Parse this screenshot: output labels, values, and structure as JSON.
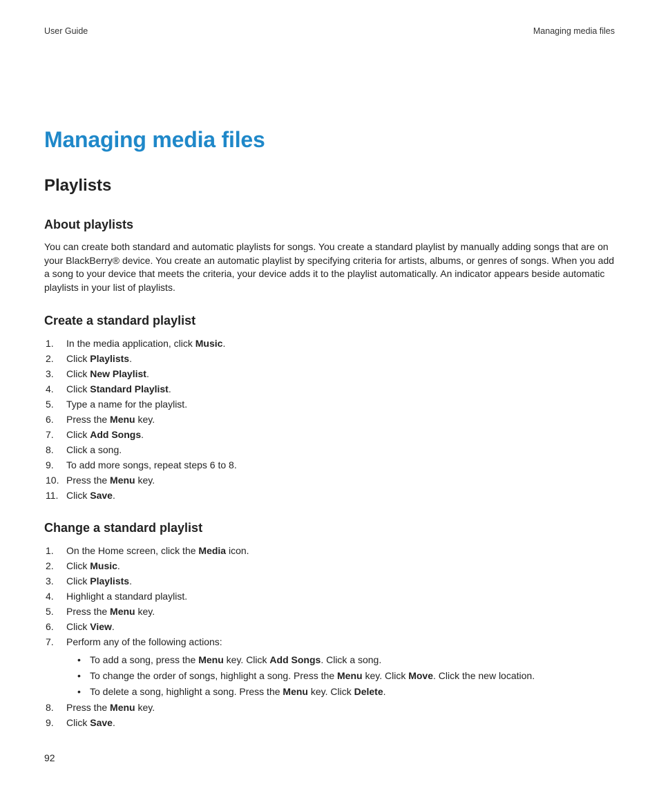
{
  "header": {
    "left": "User Guide",
    "right": "Managing media files"
  },
  "main_title": "Managing media files",
  "section_title": "Playlists",
  "about": {
    "heading": "About playlists",
    "body": "You can create both standard and automatic playlists for songs. You create a standard playlist by manually adding songs that are on your BlackBerry® device. You create an automatic playlist by specifying criteria for artists, albums, or genres of songs. When you add a song to your device that meets the criteria, your device adds it to the playlist automatically. An indicator appears beside automatic playlists in your list of playlists."
  },
  "create": {
    "heading": "Create a standard playlist",
    "steps": [
      {
        "pre": "In the media application, click ",
        "bold": "Music",
        "post": "."
      },
      {
        "pre": "Click ",
        "bold": "Playlists",
        "post": "."
      },
      {
        "pre": "Click ",
        "bold": "New Playlist",
        "post": "."
      },
      {
        "pre": "Click ",
        "bold": "Standard Playlist",
        "post": "."
      },
      {
        "pre": "Type a name for the playlist.",
        "bold": "",
        "post": ""
      },
      {
        "pre": "Press the ",
        "bold": "Menu",
        "post": " key."
      },
      {
        "pre": "Click ",
        "bold": "Add Songs",
        "post": "."
      },
      {
        "pre": "Click a song.",
        "bold": "",
        "post": ""
      },
      {
        "pre": "To add more songs, repeat steps 6 to 8.",
        "bold": "",
        "post": ""
      },
      {
        "pre": "Press the ",
        "bold": "Menu",
        "post": " key."
      },
      {
        "pre": "Click ",
        "bold": "Save",
        "post": "."
      }
    ]
  },
  "change": {
    "heading": "Change a standard playlist",
    "steps": [
      {
        "num": "1.",
        "pre": "On the Home screen, click the ",
        "bold": "Media",
        "post": " icon."
      },
      {
        "num": "2.",
        "pre": "Click ",
        "bold": "Music",
        "post": "."
      },
      {
        "num": "3.",
        "pre": "Click ",
        "bold": "Playlists",
        "post": "."
      },
      {
        "num": "4.",
        "pre": "Highlight a standard playlist.",
        "bold": "",
        "post": ""
      },
      {
        "num": "5.",
        "pre": "Press the ",
        "bold": "Menu",
        "post": " key."
      },
      {
        "num": "6.",
        "pre": "Click ",
        "bold": "View",
        "post": "."
      },
      {
        "num": "7.",
        "pre": "Perform any of the following actions:",
        "bold": "",
        "post": ""
      }
    ],
    "bullets": [
      {
        "parts": [
          {
            "t": "To add a song, press the "
          },
          {
            "b": "Menu"
          },
          {
            "t": " key. Click "
          },
          {
            "b": "Add Songs"
          },
          {
            "t": ". Click a song."
          }
        ]
      },
      {
        "parts": [
          {
            "t": "To change the order of songs, highlight a song. Press the "
          },
          {
            "b": "Menu"
          },
          {
            "t": " key. Click "
          },
          {
            "b": "Move"
          },
          {
            "t": ". Click the new location."
          }
        ]
      },
      {
        "parts": [
          {
            "t": "To delete a song, highlight a song. Press the "
          },
          {
            "b": "Menu"
          },
          {
            "t": " key. Click "
          },
          {
            "b": "Delete"
          },
          {
            "t": "."
          }
        ]
      }
    ],
    "steps_after": [
      {
        "num": "8.",
        "pre": "Press the ",
        "bold": "Menu",
        "post": " key."
      },
      {
        "num": "9.",
        "pre": "Click ",
        "bold": "Save",
        "post": "."
      }
    ]
  },
  "page_number": "92"
}
